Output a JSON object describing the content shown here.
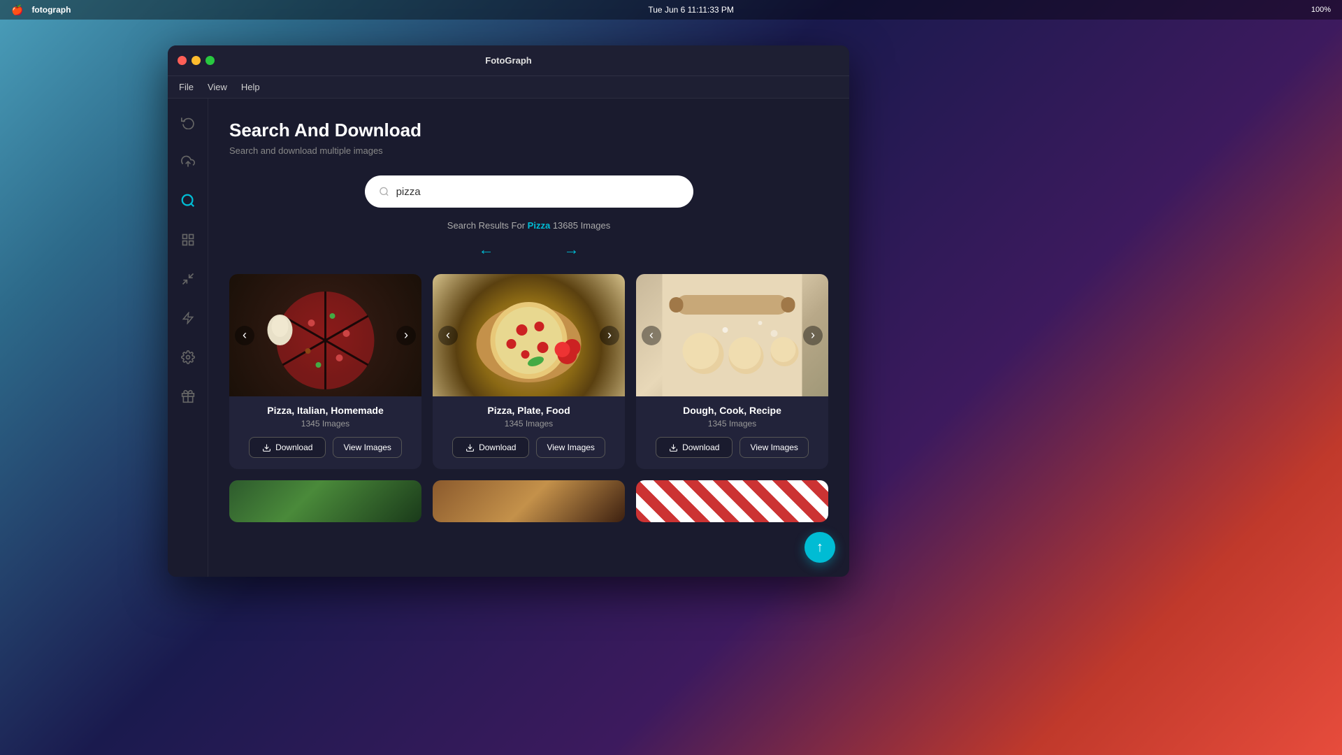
{
  "macos": {
    "apple": "🍎",
    "app_name": "fotograph",
    "time": "Tue Jun 6  11:11:33 PM",
    "battery": "100%"
  },
  "window": {
    "title": "FotoGraph"
  },
  "menu": {
    "items": [
      "File",
      "View",
      "Help"
    ]
  },
  "sidebar": {
    "icons": [
      {
        "name": "recycle-icon",
        "symbol": "♻",
        "active": false
      },
      {
        "name": "upload-icon",
        "symbol": "⬆",
        "active": false
      },
      {
        "name": "search-icon",
        "symbol": "🔍",
        "active": true
      },
      {
        "name": "grid-icon",
        "symbol": "⊞",
        "active": false
      },
      {
        "name": "shrink-icon",
        "symbol": "⊟",
        "active": false
      },
      {
        "name": "lightning-icon",
        "symbol": "⚡",
        "active": false
      },
      {
        "name": "settings-icon",
        "symbol": "⚙",
        "active": false
      },
      {
        "name": "gift-icon",
        "symbol": "🎁",
        "active": false
      }
    ]
  },
  "page": {
    "title": "Search And Download",
    "subtitle": "Search and download multiple images"
  },
  "search": {
    "value": "pizza",
    "placeholder": "pizza"
  },
  "results": {
    "label": "Search Results For",
    "query": "Pizza",
    "count": "13685 Images"
  },
  "pagination": {
    "prev": "←",
    "next": "→"
  },
  "cards": [
    {
      "id": 1,
      "title": "Pizza, Italian, Homemade",
      "count": "1345 Images",
      "theme": "pizza1",
      "download_label": "Download",
      "view_label": "View Images"
    },
    {
      "id": 2,
      "title": "Pizza, Plate, Food",
      "count": "1345 Images",
      "theme": "pizza2",
      "download_label": "Download",
      "view_label": "View Images"
    },
    {
      "id": 3,
      "title": "Dough, Cook, Recipe",
      "count": "1345 Images",
      "theme": "dough",
      "download_label": "Download",
      "view_label": "View Images"
    }
  ],
  "cards_row2": [
    {
      "id": 4,
      "theme": "veg"
    },
    {
      "id": 5,
      "theme": "pizza3"
    },
    {
      "id": 6,
      "theme": "check"
    }
  ],
  "scroll_top_label": "↑"
}
